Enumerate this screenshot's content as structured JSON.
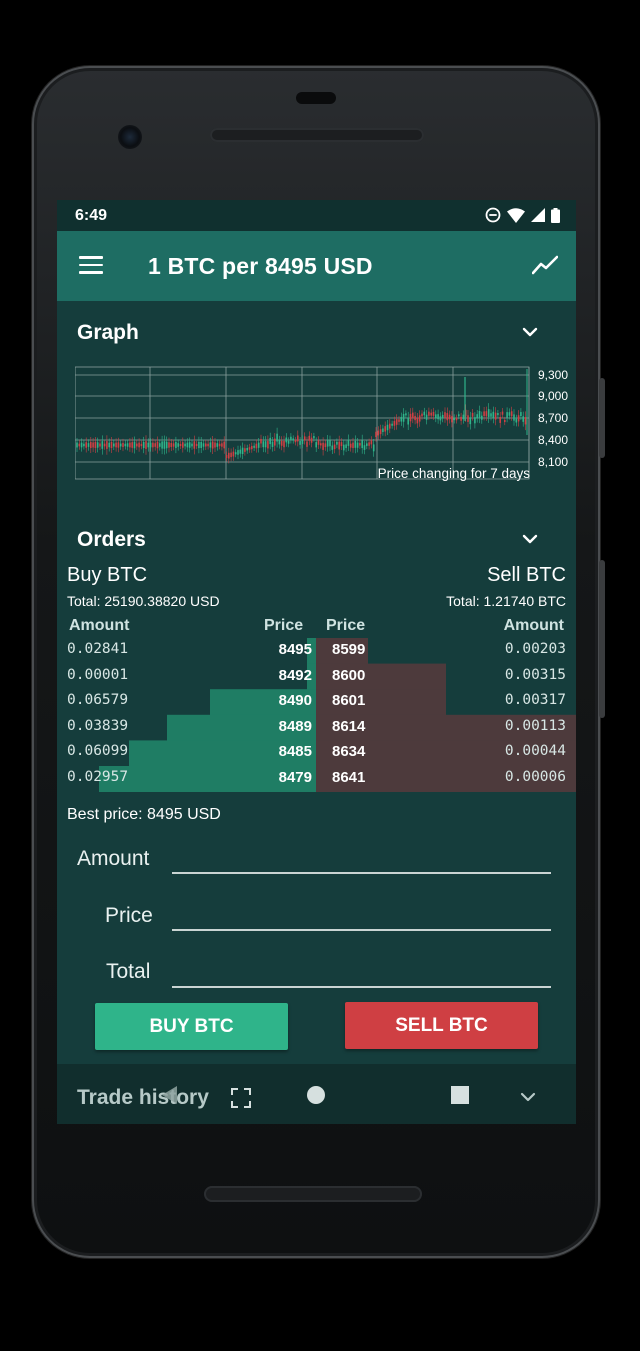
{
  "status_bar": {
    "time": "6:49"
  },
  "toolbar": {
    "title": "1 BTC per 8495 USD"
  },
  "graph": {
    "title": "Graph",
    "caption": "Price changing for 7 days",
    "y_ticks": [
      "9,300",
      "9,000",
      "8,700",
      "8,400",
      "8,100"
    ]
  },
  "orders": {
    "title": "Orders",
    "buy": {
      "title": "Buy BTC",
      "total": "Total: 25190.38820 USD"
    },
    "sell": {
      "title": "Sell BTC",
      "total": "Total: 1.21740 BTC"
    },
    "headers": {
      "amount_left": "Amount",
      "price_left": "Price",
      "price_right": "Price",
      "amount_right": "Amount"
    },
    "rows": [
      {
        "buy_amount": "0.02841",
        "buy_price": "8495",
        "sell_price": "8599",
        "sell_amount": "0.00203"
      },
      {
        "buy_amount": "0.00001",
        "buy_price": "8492",
        "sell_price": "8600",
        "sell_amount": "0.00315"
      },
      {
        "buy_amount": "0.06579",
        "buy_price": "8490",
        "sell_price": "8601",
        "sell_amount": "0.00317"
      },
      {
        "buy_amount": "0.03839",
        "buy_price": "8489",
        "sell_price": "8614",
        "sell_amount": "0.00113"
      },
      {
        "buy_amount": "0.06099",
        "buy_price": "8485",
        "sell_price": "8634",
        "sell_amount": "0.00044"
      },
      {
        "buy_amount": "0.02957",
        "buy_price": "8479",
        "sell_price": "8641",
        "sell_amount": "0.00006"
      }
    ],
    "best_price": "Best price: 8495 USD"
  },
  "form": {
    "amount_label": "Amount",
    "price_label": "Price",
    "total_label": "Total",
    "buy_button": "BUY BTC",
    "sell_button": "SELL BTC"
  },
  "trade_history": {
    "label": "Trade history"
  },
  "colors": {
    "toolbar": "#1e6d63",
    "background": "#153d3c",
    "buy": "#2fb48a",
    "sell": "#cf3f43",
    "buy_depth": "#1f7d64",
    "sell_depth": "#4d3a3c"
  },
  "icons": [
    "menu-icon",
    "trending-icon",
    "chevron-down-icon",
    "dnd-icon",
    "wifi-icon",
    "signal-icon",
    "battery-icon",
    "back-icon",
    "fullscreen-icon",
    "home-icon",
    "recents-icon"
  ]
}
